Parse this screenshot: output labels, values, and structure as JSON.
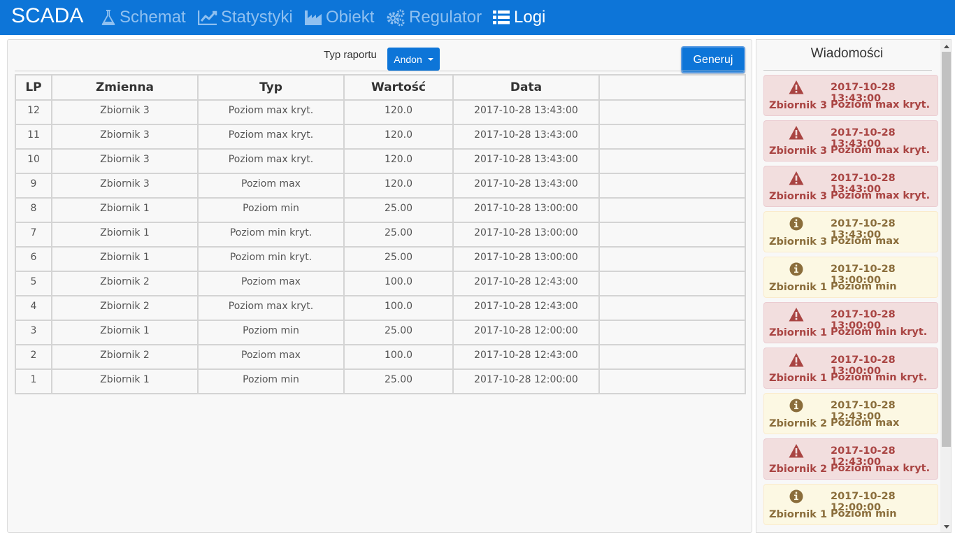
{
  "navbar": {
    "brand": "SCADA",
    "items": [
      {
        "label": "Schemat",
        "icon": "flask-icon"
      },
      {
        "label": "Statystyki",
        "icon": "line-chart-icon"
      },
      {
        "label": "Obiekt",
        "icon": "industry-icon"
      },
      {
        "label": "Regulator",
        "icon": "cogs-icon"
      },
      {
        "label": "Logi",
        "icon": "list-icon",
        "active": true
      }
    ]
  },
  "report": {
    "type_label": "Typ raportu",
    "type_value": "Andon",
    "generate_label": "Generuj"
  },
  "table": {
    "headers": [
      "LP",
      "Zmienna",
      "Typ",
      "Wartość",
      "Data",
      ""
    ],
    "rows": [
      [
        "12",
        "Zbiornik 3",
        "Poziom max kryt.",
        "120.0",
        "2017-10-28 13:43:00",
        ""
      ],
      [
        "11",
        "Zbiornik 3",
        "Poziom max kryt.",
        "120.0",
        "2017-10-28 13:43:00",
        ""
      ],
      [
        "10",
        "Zbiornik 3",
        "Poziom max kryt.",
        "120.0",
        "2017-10-28 13:43:00",
        ""
      ],
      [
        "9",
        "Zbiornik 3",
        "Poziom max",
        "120.0",
        "2017-10-28 13:43:00",
        ""
      ],
      [
        "8",
        "Zbiornik 1",
        "Poziom min",
        "25.00",
        "2017-10-28 13:00:00",
        ""
      ],
      [
        "7",
        "Zbiornik 1",
        "Poziom min kryt.",
        "25.00",
        "2017-10-28 13:00:00",
        ""
      ],
      [
        "6",
        "Zbiornik 1",
        "Poziom min kryt.",
        "25.00",
        "2017-10-28 13:00:00",
        ""
      ],
      [
        "5",
        "Zbiornik 2",
        "Poziom max",
        "100.0",
        "2017-10-28 12:43:00",
        ""
      ],
      [
        "4",
        "Zbiornik 2",
        "Poziom max kryt.",
        "100.0",
        "2017-10-28 12:43:00",
        ""
      ],
      [
        "3",
        "Zbiornik 1",
        "Poziom min",
        "25.00",
        "2017-10-28 12:00:00",
        ""
      ],
      [
        "2",
        "Zbiornik 2",
        "Poziom max",
        "100.0",
        "2017-10-28 12:43:00",
        ""
      ],
      [
        "1",
        "Zbiornik 1",
        "Poziom min",
        "25.00",
        "2017-10-28 12:00:00",
        ""
      ]
    ]
  },
  "messages": {
    "title": "Wiadomości",
    "items": [
      {
        "level": "danger",
        "icon": "warning-icon",
        "variable": "Zbiornik 3",
        "date": "2017-10-28 13:43:00",
        "type": "Poziom max kryt."
      },
      {
        "level": "danger",
        "icon": "warning-icon",
        "variable": "Zbiornik 3",
        "date": "2017-10-28 13:43:00",
        "type": "Poziom max kryt."
      },
      {
        "level": "danger",
        "icon": "warning-icon",
        "variable": "Zbiornik 3",
        "date": "2017-10-28 13:43:00",
        "type": "Poziom max kryt."
      },
      {
        "level": "info",
        "icon": "info-icon",
        "variable": "Zbiornik 3",
        "date": "2017-10-28 13:43:00",
        "type": "Poziom max"
      },
      {
        "level": "info",
        "icon": "info-icon",
        "variable": "Zbiornik 1",
        "date": "2017-10-28 13:00:00",
        "type": "Poziom min"
      },
      {
        "level": "danger",
        "icon": "warning-icon",
        "variable": "Zbiornik 1",
        "date": "2017-10-28 13:00:00",
        "type": "Poziom min kryt."
      },
      {
        "level": "danger",
        "icon": "warning-icon",
        "variable": "Zbiornik 1",
        "date": "2017-10-28 13:00:00",
        "type": "Poziom min kryt."
      },
      {
        "level": "info",
        "icon": "info-icon",
        "variable": "Zbiornik 2",
        "date": "2017-10-28 12:43:00",
        "type": "Poziom max"
      },
      {
        "level": "danger",
        "icon": "warning-icon",
        "variable": "Zbiornik 2",
        "date": "2017-10-28 12:43:00",
        "type": "Poziom max kryt."
      },
      {
        "level": "info",
        "icon": "info-icon",
        "variable": "Zbiornik 1",
        "date": "2017-10-28 12:00:00",
        "type": "Poziom min"
      }
    ]
  },
  "colors": {
    "navbar": "#0d75d8",
    "nav_inactive": "#8fc0f0",
    "danger_bg": "#f2dede",
    "danger_text": "#a94442",
    "info_bg": "#fcf8e3",
    "info_text": "#8a6d3b"
  }
}
